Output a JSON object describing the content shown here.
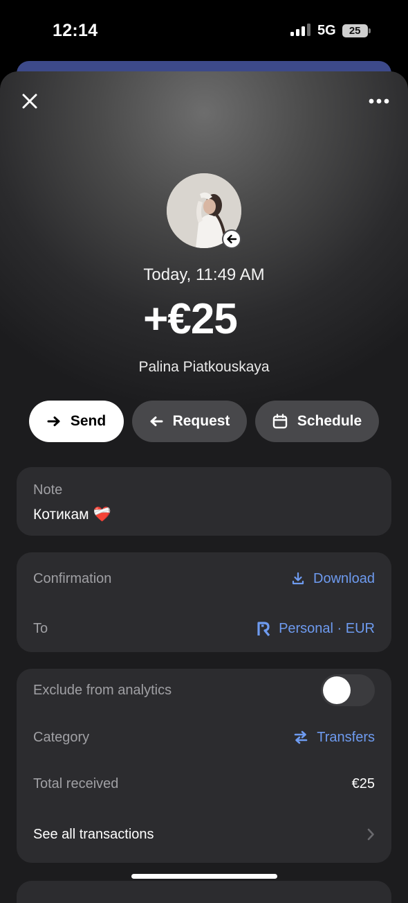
{
  "status_bar": {
    "time": "12:14",
    "network": "5G",
    "battery": "25"
  },
  "header": {
    "close_icon": "close-icon",
    "more_icon": "more-horizontal-icon"
  },
  "transaction": {
    "date": "Today, 11:49 AM",
    "amount": "+€25",
    "counterparty": "Palina Piatkouskaya",
    "direction_icon": "arrow-left-icon"
  },
  "actions": [
    {
      "label": "Send",
      "icon": "arrow-right-icon"
    },
    {
      "label": "Request",
      "icon": "arrow-left-icon"
    },
    {
      "label": "Schedule",
      "icon": "calendar-icon"
    }
  ],
  "note": {
    "label": "Note",
    "text": "Котикам",
    "emoji": "❤️‍🩹"
  },
  "details": {
    "confirmation_label": "Confirmation",
    "download_label": "Download",
    "to_label": "To",
    "to_value": "Personal · EUR"
  },
  "analytics": {
    "exclude_label": "Exclude from analytics",
    "exclude_enabled": false,
    "category_label": "Category",
    "category_value": "Transfers",
    "total_label": "Total received",
    "total_value": "€25",
    "see_all_label": "See all transactions"
  },
  "colors": {
    "accent_link": "#6e9bf0",
    "card_bg": "#2c2c2f",
    "sheet_bg": "#1c1c1e"
  }
}
